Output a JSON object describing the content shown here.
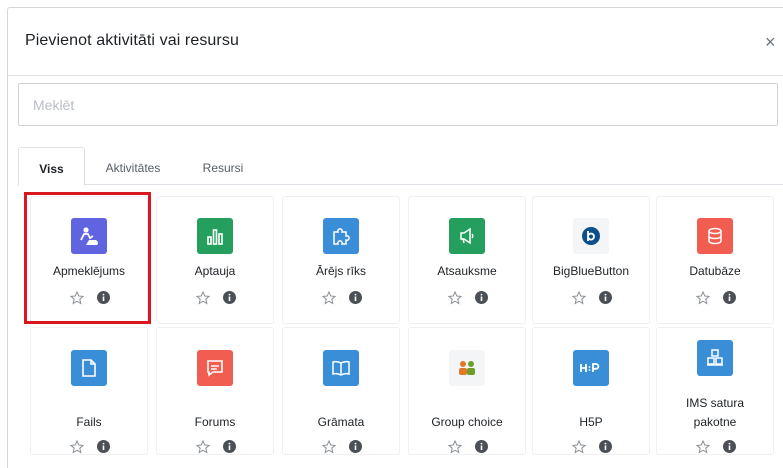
{
  "modal": {
    "title": "Pievienot aktivitāti vai resursu",
    "close_label": "×"
  },
  "search": {
    "placeholder": "Meklēt",
    "value": ""
  },
  "tabs": [
    {
      "label": "Viss",
      "active": true
    },
    {
      "label": "Aktivitātes",
      "active": false
    },
    {
      "label": "Resursi",
      "active": false
    }
  ],
  "items": [
    {
      "label": "Apmeklējums",
      "icon": "attendance-icon",
      "color": "#6164e0",
      "highlighted": true
    },
    {
      "label": "Aptauja",
      "icon": "bar-chart-icon",
      "color": "#249f5e"
    },
    {
      "label": "Ārējs rīks",
      "icon": "puzzle-icon",
      "color": "#3a8ed8"
    },
    {
      "label": "Atsauksme",
      "icon": "megaphone-icon",
      "color": "#249f5e"
    },
    {
      "label": "BigBlueButton",
      "icon": "bigbluebutton-icon",
      "color": "#f3f5f7"
    },
    {
      "label": "Datubāze",
      "icon": "database-icon",
      "color": "#f15d50"
    },
    {
      "label": "Fails",
      "icon": "file-icon",
      "color": "#3a8ed8"
    },
    {
      "label": "Forums",
      "icon": "forum-icon",
      "color": "#f15d50"
    },
    {
      "label": "Grāmata",
      "icon": "book-icon",
      "color": "#3a8ed8"
    },
    {
      "label": "Group choice",
      "icon": "group-choice-icon",
      "color": "#f3f5f7"
    },
    {
      "label": "H5P",
      "icon": "h5p-icon",
      "color": "#3a8ed8"
    },
    {
      "label": "IMS satura pakotne",
      "label_lines": [
        "IMS satura",
        "pakotne"
      ],
      "icon": "ims-package-icon",
      "color": "#3a8ed8"
    }
  ]
}
